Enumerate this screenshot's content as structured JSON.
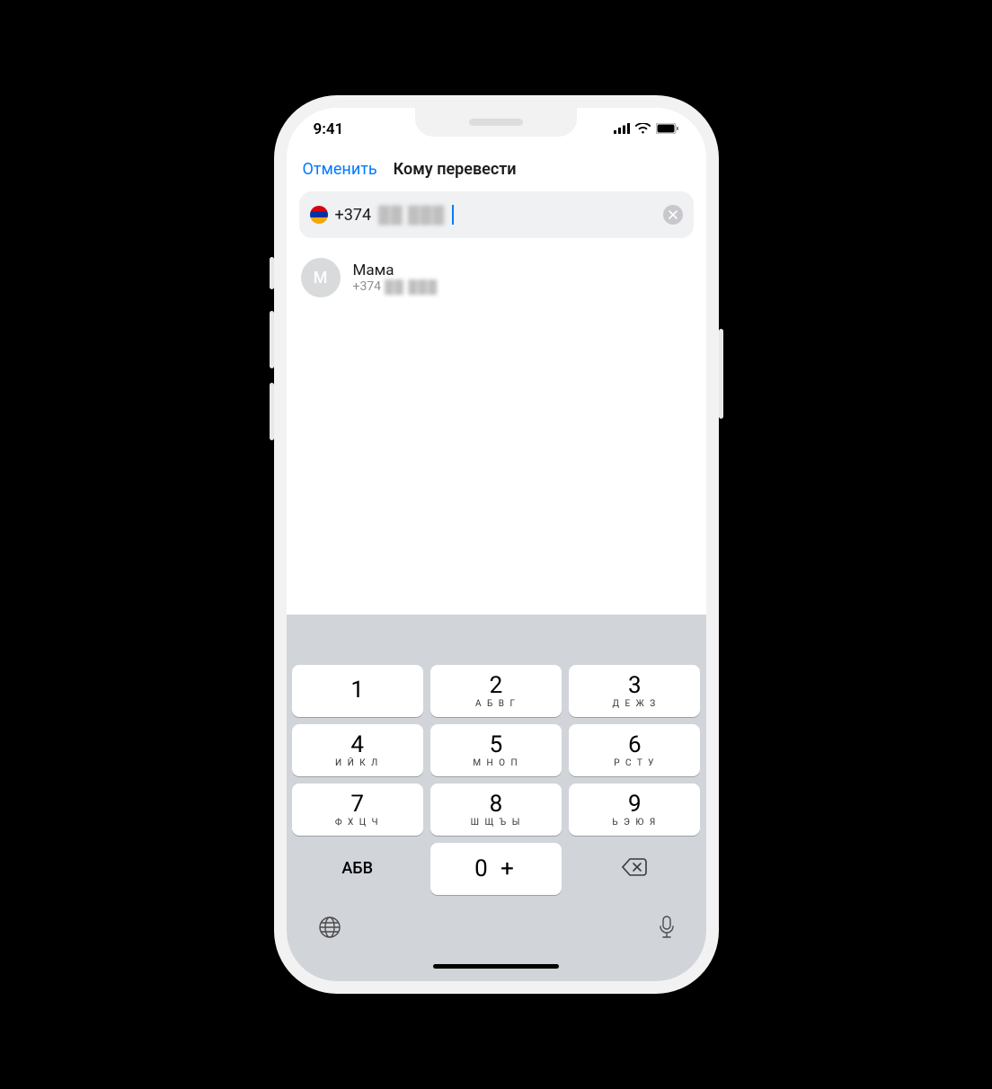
{
  "status": {
    "time": "9:41"
  },
  "nav": {
    "cancel": "Отменить",
    "title": "Кому перевести"
  },
  "search": {
    "prefix": "+374",
    "masked": "██ ███"
  },
  "contact": {
    "initial": "М",
    "name": "Мама",
    "phone_prefix": "+374",
    "phone_masked": "██ ███"
  },
  "keyboard": {
    "keys": [
      [
        {
          "d": "1",
          "l": ""
        },
        {
          "d": "2",
          "l": "А Б В Г"
        },
        {
          "d": "3",
          "l": "Д Е Ж З"
        }
      ],
      [
        {
          "d": "4",
          "l": "И Й К Л"
        },
        {
          "d": "5",
          "l": "М Н О П"
        },
        {
          "d": "6",
          "l": "Р С Т У"
        }
      ],
      [
        {
          "d": "7",
          "l": "Ф Х Ц Ч"
        },
        {
          "d": "8",
          "l": "Ш Щ Ъ Ы"
        },
        {
          "d": "9",
          "l": "Ь Э Ю Я"
        }
      ]
    ],
    "abc": "АБВ",
    "zero": "0 +"
  }
}
